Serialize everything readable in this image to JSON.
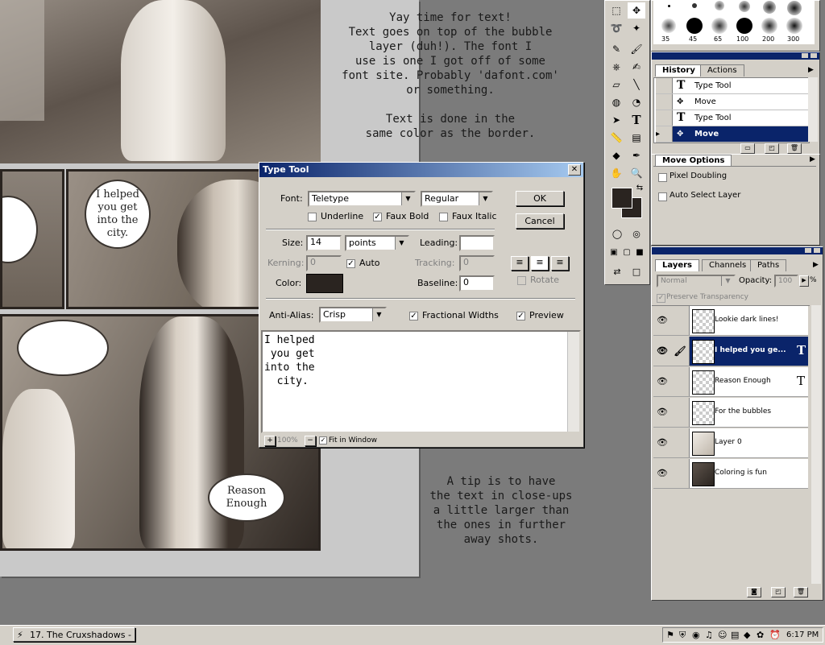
{
  "tutorial": {
    "text_top": "Yay time for text!\nText goes on top of the bubble\nlayer (duh!).  The font I\nuse is one I got off of some\nfont site.  Probably 'dafont.com'\nor something.\n\nText is done in the\nsame color as the border.",
    "text_bottom": "A tip is to have\nthe text in close-ups\na little larger than\nthe ones in further\naway shots."
  },
  "comic": {
    "bubble_1": "I helped\nyou get\ninto the\ncity.",
    "bubble_2": "Reason\nEnough"
  },
  "type_dialog": {
    "title": "Type Tool",
    "font_label": "Font:",
    "font_value": "Teletype",
    "style_value": "Regular",
    "underline_label": "Underline",
    "underline_checked": false,
    "faux_bold_label": "Faux Bold",
    "faux_bold_checked": true,
    "faux_italic_label": "Faux Italic",
    "faux_italic_checked": false,
    "size_label": "Size:",
    "size_value": "14",
    "size_unit": "points",
    "leading_label": "Leading:",
    "leading_value": "",
    "kerning_label": "Kerning:",
    "kerning_value": "0",
    "auto_label": "Auto",
    "auto_checked": true,
    "tracking_label": "Tracking:",
    "tracking_value": "0",
    "color_label": "Color:",
    "color_swatch": "#2a2420",
    "baseline_label": "Baseline:",
    "baseline_value": "0",
    "rotate_label": "Rotate",
    "antialias_label": "Anti-Alias:",
    "antialias_value": "Crisp",
    "fractional_label": "Fractional Widths",
    "fractional_checked": true,
    "preview_label": "Preview",
    "preview_checked": true,
    "ok_label": "OK",
    "cancel_label": "Cancel",
    "text_content": "I helped\n you get\ninto the\n  city.",
    "zoom_value": "100%",
    "fit_label": "Fit in Window",
    "fit_checked": true
  },
  "brushes": {
    "sizes": [
      "35",
      "45",
      "65",
      "100",
      "200",
      "300"
    ]
  },
  "history_palette": {
    "tabs": [
      "History",
      "Actions"
    ],
    "items": [
      "Type Tool",
      "Move",
      "Type Tool",
      "Move"
    ],
    "selected_index": 3
  },
  "options_palette": {
    "title": "Move Options",
    "pixel_doubling": "Pixel Doubling",
    "auto_select": "Auto Select Layer"
  },
  "layers_palette": {
    "tabs": [
      "Layers",
      "Channels",
      "Paths"
    ],
    "blend_mode": "Normal",
    "opacity_label": "Opacity:",
    "opacity_value": "100",
    "opacity_unit": "%",
    "preserve_label": "Preserve Transparency",
    "layers": [
      {
        "name": "Lookie dark lines!",
        "type": "raster"
      },
      {
        "name": "I helped you ge...",
        "type": "text"
      },
      {
        "name": "Reason Enough",
        "type": "text"
      },
      {
        "name": "For the bubbles",
        "type": "raster"
      },
      {
        "name": "Layer 0",
        "type": "raster"
      },
      {
        "name": "Coloring is fun",
        "type": "raster"
      }
    ],
    "selected_index": 1
  },
  "taskbar": {
    "task_label": "17. The Cruxshadows - ...",
    "clock": "6:17 PM"
  },
  "colors": {
    "titlebar": "#0a246a",
    "foreground_swatch": "#2a2420",
    "background_swatch": "#2a2420"
  }
}
